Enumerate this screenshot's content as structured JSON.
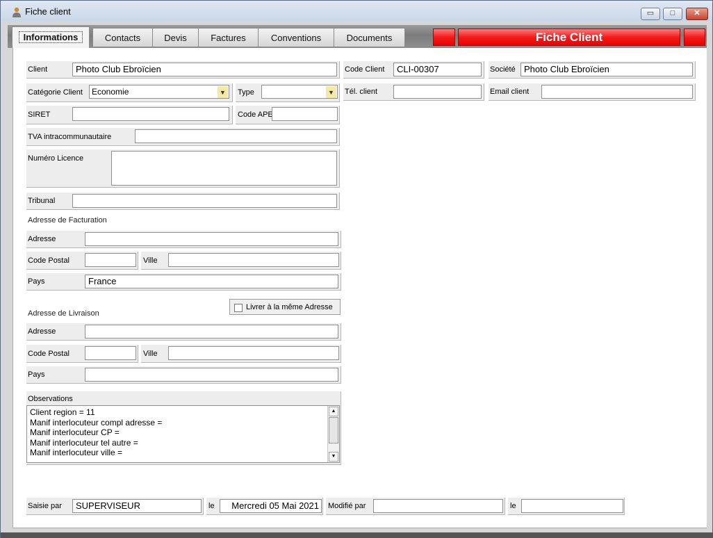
{
  "window": {
    "title": "Fiche client",
    "minimize": "▭",
    "maximize": "□",
    "close": "✕"
  },
  "tabs": [
    {
      "label": "Informations"
    },
    {
      "label": "Contacts"
    },
    {
      "label": "Devis"
    },
    {
      "label": "Factures"
    },
    {
      "label": "Conventions"
    },
    {
      "label": "Documents"
    }
  ],
  "header_title": "Fiche Client",
  "fields": {
    "client": {
      "label": "Client",
      "value": "Photo Club Ebroïcien"
    },
    "code_client": {
      "label": "Code Client",
      "value": "CLI-00307"
    },
    "societe": {
      "label": "Société",
      "value": "Photo Club Ebroïcien"
    },
    "categorie": {
      "label": "Catégorie Client",
      "value": "Economie"
    },
    "type": {
      "label": "Type",
      "value": ""
    },
    "tel_client": {
      "label": "Tél. client",
      "value": ""
    },
    "email_client": {
      "label": "Email client",
      "value": ""
    },
    "siret": {
      "label": "SIRET",
      "value": ""
    },
    "code_ape": {
      "label": "Code APE",
      "value": ""
    },
    "tva": {
      "label": "TVA intracommunautaire",
      "value": ""
    },
    "licence": {
      "label": "Numéro Licence",
      "value": ""
    },
    "tribunal": {
      "label": "Tribunal",
      "value": ""
    }
  },
  "facturation": {
    "title": "Adresse de Facturation",
    "adresse": {
      "label": "Adresse",
      "value": ""
    },
    "cp": {
      "label": "Code Postal",
      "value": ""
    },
    "ville": {
      "label": "Ville",
      "value": ""
    },
    "pays": {
      "label": "Pays",
      "value": "France"
    }
  },
  "livraison": {
    "title": "Adresse de Livraison",
    "same_label": "Livrer à la même Adresse",
    "same_checked": false,
    "adresse": {
      "label": "Adresse",
      "value": ""
    },
    "cp": {
      "label": "Code Postal",
      "value": ""
    },
    "ville": {
      "label": "Ville",
      "value": ""
    },
    "pays": {
      "label": "Pays",
      "value": ""
    }
  },
  "observations": {
    "label": "Observations",
    "lines": [
      "Client region = 11",
      "Manif interlocuteur compl adresse =",
      "Manif interlocuteur CP =",
      "Manif interlocuteur tel autre =",
      "Manif interlocuteur ville ="
    ]
  },
  "footer": {
    "saisie_label": "Saisie par",
    "saisie_value": "SUPERVISEUR",
    "le_label": "le",
    "le_value": "Mercredi 05 Mai 2021",
    "modifie_label": "Modifié par",
    "modifie_value": "",
    "le2_label": "le",
    "le2_value": ""
  },
  "icons": {
    "app": "user-icon",
    "dropdown": "chevron-down-icon",
    "scroll_up": "arrow-up-icon",
    "scroll_down": "arrow-down-icon"
  }
}
